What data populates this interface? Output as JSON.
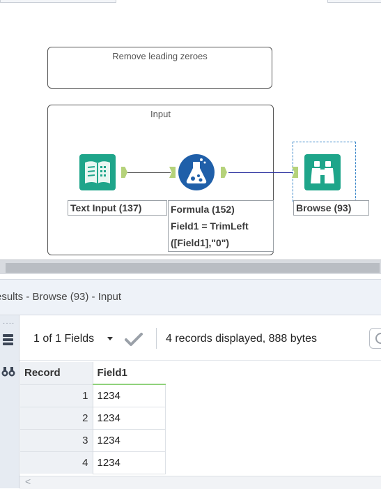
{
  "canvas": {
    "comment_text": "Remove leading zeroes",
    "container_title": "Input",
    "tools": {
      "text_input": {
        "label": "Text Input (137)",
        "icon": "text-input-book-icon",
        "color": "#1ea58a"
      },
      "formula": {
        "label_line1": "Formula (152)",
        "label_line2": "Field1 = TrimLeft",
        "label_line3": "([Field1],\"0\")",
        "icon": "formula-flask-icon",
        "color": "#1f5fa9"
      },
      "browse": {
        "label": "Browse (93)",
        "icon": "binoculars-icon",
        "color": "#1ea58a"
      }
    },
    "connection_colors": {
      "input_to_formula": "#555555",
      "formula_to_browse": "#2a2f9e"
    },
    "anchor_color": "#b5d27a"
  },
  "results": {
    "title": "esults - Browse (93) - Input",
    "fields_selector": "1 of 1 Fields",
    "records_info": "4 records displayed, 888 bytes",
    "columns": [
      "Record",
      "Field1"
    ],
    "rows": [
      {
        "record": "1",
        "field1": "1234"
      },
      {
        "record": "2",
        "field1": "1234"
      },
      {
        "record": "3",
        "field1": "1234"
      },
      {
        "record": "4",
        "field1": "1234"
      }
    ],
    "scroll_left_glyph": "<"
  }
}
